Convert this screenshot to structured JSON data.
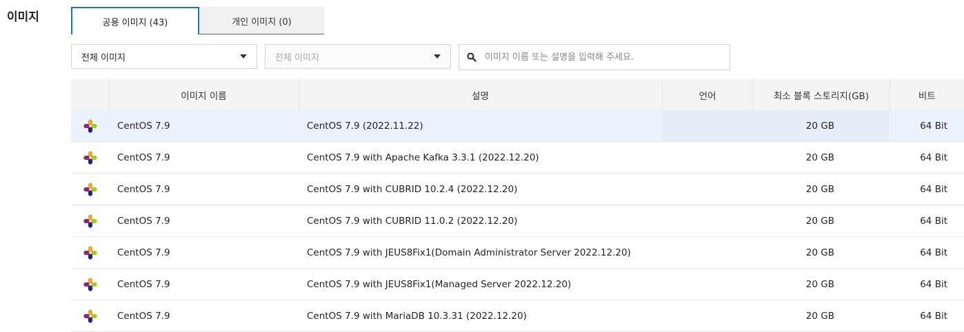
{
  "section": {
    "title": "이미지"
  },
  "tabs": [
    {
      "label": "공용 이미지 (43)",
      "active": true
    },
    {
      "label": "개인 이미지 (0)",
      "active": false
    }
  ],
  "filters": {
    "category_select": {
      "value": "전체 이미지"
    },
    "sub_select": {
      "value": "전체 이미지",
      "disabled": true
    },
    "search": {
      "placeholder": "이미지 이름 또는 설명을 입력해 주세요.",
      "value": ""
    }
  },
  "table": {
    "headers": {
      "icon": "",
      "name": "이미지 이름",
      "desc": "설명",
      "lang": "언어",
      "size": "최소 블록 스토리지(GB)",
      "bit": "비트"
    },
    "rows": [
      {
        "icon": "centos-logo-icon",
        "name": "CentOS 7.9",
        "desc": "CentOS 7.9 (2022.11.22)",
        "lang": "",
        "size": "20 GB",
        "bit": "64 Bit",
        "selected": true
      },
      {
        "icon": "centos-logo-icon",
        "name": "CentOS 7.9",
        "desc": "CentOS 7.9 with Apache Kafka 3.3.1 (2022.12.20)",
        "lang": "",
        "size": "20 GB",
        "bit": "64 Bit"
      },
      {
        "icon": "centos-logo-icon",
        "name": "CentOS 7.9",
        "desc": "CentOS 7.9 with CUBRID 10.2.4 (2022.12.20)",
        "lang": "",
        "size": "20 GB",
        "bit": "64 Bit"
      },
      {
        "icon": "centos-logo-icon",
        "name": "CentOS 7.9",
        "desc": "CentOS 7.9 with CUBRID 11.0.2 (2022.12.20)",
        "lang": "",
        "size": "20 GB",
        "bit": "64 Bit"
      },
      {
        "icon": "centos-logo-icon",
        "name": "CentOS 7.9",
        "desc": "CentOS 7.9 with JEUS8Fix1(Domain Administrator Server 2022.12.20)",
        "lang": "",
        "size": "20 GB",
        "bit": "64 Bit"
      },
      {
        "icon": "centos-logo-icon",
        "name": "CentOS 7.9",
        "desc": "CentOS 7.9 with JEUS8Fix1(Managed Server 2022.12.20)",
        "lang": "",
        "size": "20 GB",
        "bit": "64 Bit"
      },
      {
        "icon": "centos-logo-icon",
        "name": "CentOS 7.9",
        "desc": "CentOS 7.9 with MariaDB 10.3.31 (2022.12.20)",
        "lang": "",
        "size": "20 GB",
        "bit": "64 Bit"
      }
    ]
  },
  "colors": {
    "accent": "#1f72c9",
    "selected_row": "#eaf2fd",
    "header_bg": "#f4f4f4",
    "logo_yellow": "#efa724",
    "logo_green": "#9ccd2a",
    "logo_blue": "#262577",
    "logo_purple": "#932279"
  }
}
